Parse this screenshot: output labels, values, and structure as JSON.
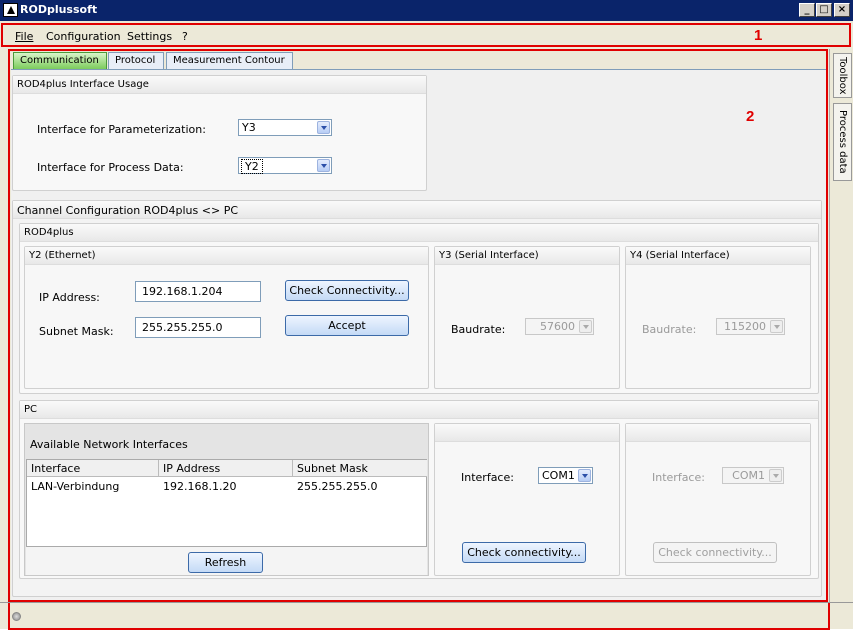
{
  "window": {
    "title": "RODplussoft",
    "minimize": "_",
    "maximize": "□",
    "close": "×"
  },
  "menu": {
    "items": [
      "File",
      "Configuration",
      "Settings",
      "?"
    ]
  },
  "annotations": {
    "one": "1",
    "two": "2"
  },
  "tabs": [
    "Communication",
    "Protocol",
    "Measurement Contour"
  ],
  "side_tabs": [
    "Toolbox",
    "Process data"
  ],
  "usage": {
    "title": "ROD4plus Interface Usage",
    "param_label": "Interface for Parameterization:",
    "param_value": "Y3",
    "process_label": "Interface for Process Data:",
    "process_value": "Y2"
  },
  "channel": {
    "title": "Channel Configuration ROD4plus <> PC",
    "rod_title": "ROD4plus",
    "y2": {
      "title": "Y2 (Ethernet)",
      "ip_label": "IP Address:",
      "ip_value": "192.168.1.204",
      "mask_label": "Subnet Mask:",
      "mask_value": "255.255.255.0",
      "check_btn": "Check Connectivity...",
      "accept_btn": "Accept"
    },
    "y3": {
      "title": "Y3 (Serial Interface)",
      "baud_label": "Baudrate:",
      "baud_value": "57600"
    },
    "y4": {
      "title": "Y4 (Serial Interface)",
      "baud_label": "Baudrate:",
      "baud_value": "115200"
    },
    "pc_title": "PC",
    "net": {
      "title": "Available Network Interfaces",
      "columns": [
        "Interface",
        "IP Address",
        "Subnet Mask"
      ],
      "rows": [
        [
          "LAN-Verbindung",
          "192.168.1.20",
          "255.255.255.0"
        ]
      ],
      "refresh_btn": "Refresh"
    },
    "pc_serial1": {
      "if_label": "Interface:",
      "if_value": "COM1",
      "check_btn": "Check connectivity..."
    },
    "pc_serial2": {
      "if_label": "Interface:",
      "if_value": "COM1",
      "check_btn": "Check connectivity..."
    }
  }
}
